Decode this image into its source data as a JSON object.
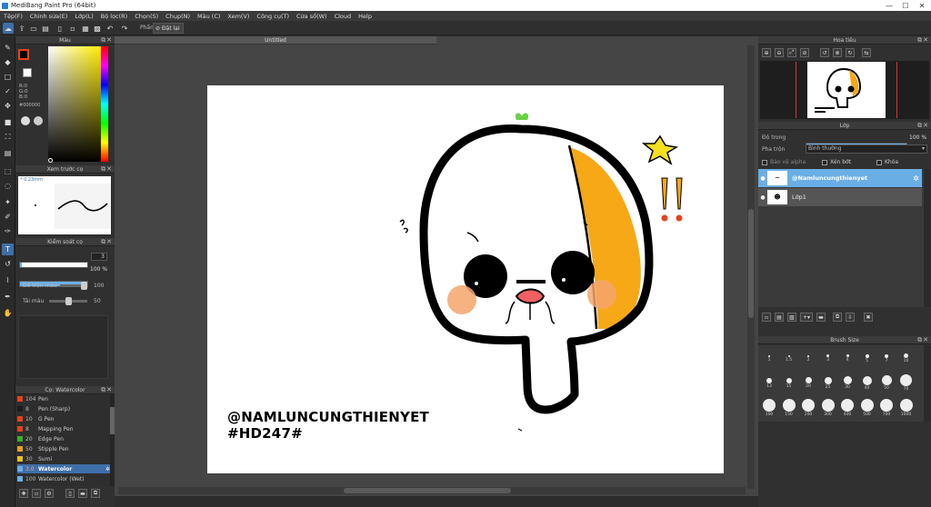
{
  "window": {
    "title": "MediBang Paint Pro (64bit)",
    "min": "—",
    "max": "☐",
    "close": "✕"
  },
  "menu": [
    "Tệp(F)",
    "Chỉnh sửa(E)",
    "Lớp(L)",
    "Bộ lọc(R)",
    "Chọn(S)",
    "Chụp(N)",
    "Màu (C)",
    "Xem(V)",
    "Công cụ(T)",
    "Cửa sổ(W)",
    "Cloud",
    "Help"
  ],
  "toolbar": {
    "snap_label": "Phẩm",
    "snap_off_label": "Đặt lại"
  },
  "color_panel": {
    "title": "Màu",
    "rgb": [
      "R:0",
      "G:0",
      "B:0"
    ],
    "hex": "#000000",
    "primary_color": "#000000",
    "secondary_color": "#ffffff",
    "accent": "#e8401c"
  },
  "brush_preview": {
    "title": "Xem trước cọ",
    "size": "* 0.23mm"
  },
  "brush_control": {
    "title": "Kiểm soát cọ",
    "size_value": "3",
    "opacity_value": "100 %",
    "blend_label": "Dễ trộn màu",
    "blend_value": "100",
    "paint_label": "Tái màu",
    "paint_value": "50",
    "opacity_fraction": 1.0,
    "blend_fraction": 1.0,
    "paint_fraction": 0.5
  },
  "brush_list": {
    "title": "Cọ: Watercolor",
    "items": [
      {
        "num": "104",
        "name": "Pen",
        "color": "#e8401c"
      },
      {
        "num": "8",
        "name": "Pen (Sharp)",
        "color": "#1b1b1b"
      },
      {
        "num": "10",
        "name": "G Pen",
        "color": "#e8401c"
      },
      {
        "num": "8",
        "name": "Mapping Pen",
        "color": "#e8401c"
      },
      {
        "num": "20",
        "name": "Edge Pen",
        "color": "#3cb02a"
      },
      {
        "num": "50",
        "name": "Stipple Pen",
        "color": "#e8a020"
      },
      {
        "num": "30",
        "name": "Sumi",
        "color": "#e8c020"
      },
      {
        "num": "3.0",
        "name": "Watercolor",
        "color": "#3e6fa8",
        "selected": true
      },
      {
        "num": "100",
        "name": "Watercolor (Wet)",
        "color": "#6aaee6"
      }
    ]
  },
  "canvas": {
    "tab": "Untitled",
    "text_line1": "@NAMLUNCUNGTHIENYET",
    "text_line2": "#HD247#",
    "orange": "#f7a816",
    "blush": "#f4a46a",
    "sprout": "#6ad040",
    "star": "#f5e020"
  },
  "navigator": {
    "title": "Hoa tiêu"
  },
  "layers": {
    "title": "Lớp",
    "opacity_label": "Độ trong",
    "opacity_value": "100 %",
    "opacity_fraction": 1.0,
    "blend_label": "Pha trộn",
    "blend_value": "Bình thường",
    "protect_alpha": "Bảo vệ alpha",
    "clipping": "Xén bớt",
    "lock": "Khóa",
    "items": [
      {
        "name": "@Namluncungthienyet",
        "selected": true
      },
      {
        "name": "Lớp1",
        "selected": false
      }
    ]
  },
  "brush_size": {
    "title": "Brush Size",
    "sizes": [
      "1",
      "1.5",
      "2",
      "3",
      "4",
      "5",
      "7",
      "10",
      "13",
      "15",
      "20",
      "25",
      "30",
      "40",
      "50",
      "70",
      "100",
      "150",
      "200",
      "300",
      "400",
      "500",
      "700",
      "1000"
    ]
  }
}
